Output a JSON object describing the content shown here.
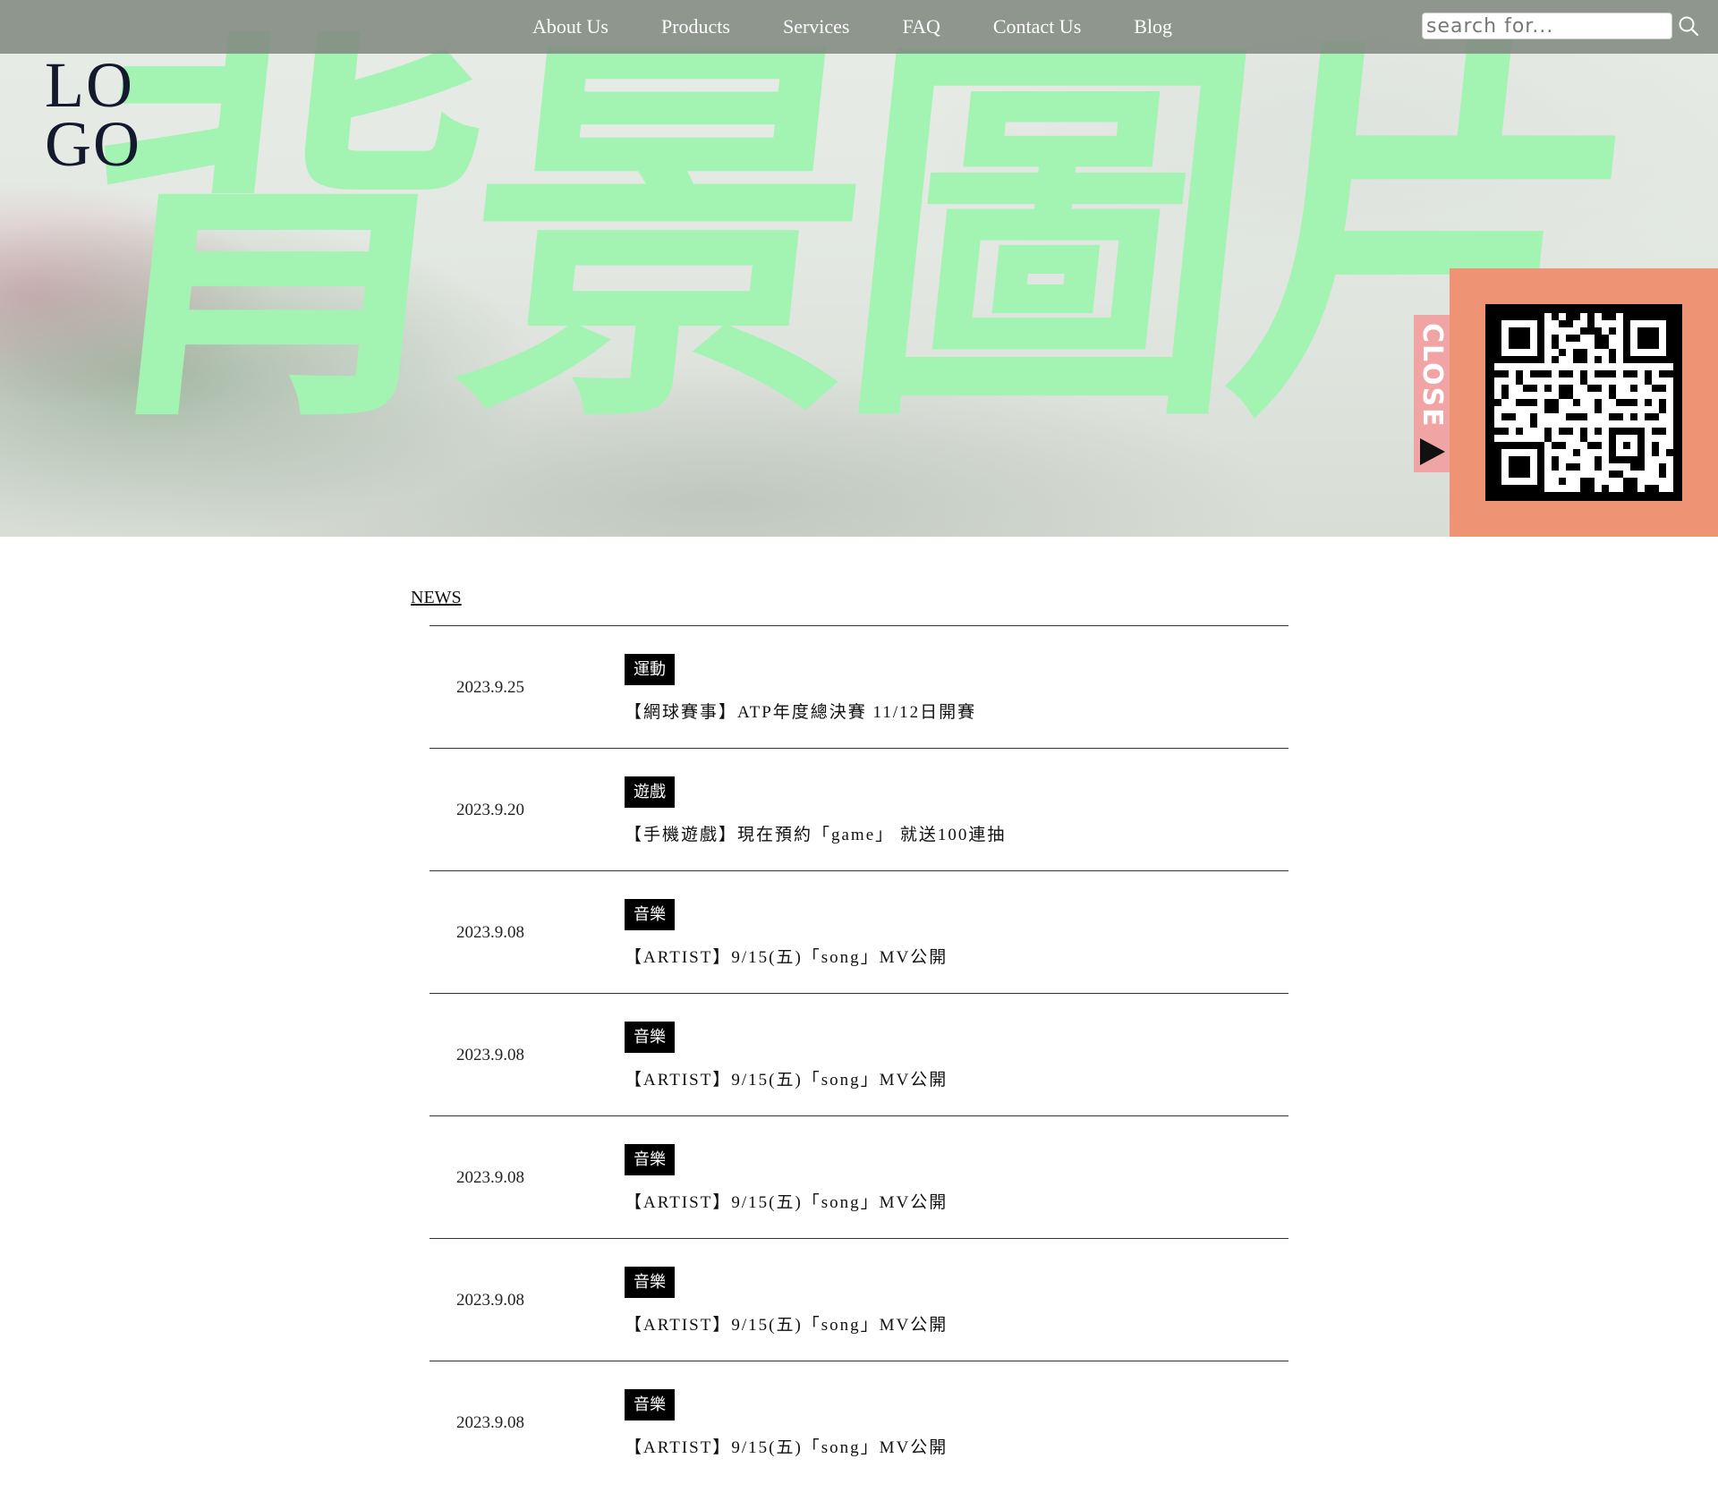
{
  "hero": {
    "background_text": "背景圖片"
  },
  "logo": {
    "line1": "LO",
    "line2": "GO"
  },
  "nav": {
    "items": [
      {
        "label": "About Us"
      },
      {
        "label": "Products"
      },
      {
        "label": "Services"
      },
      {
        "label": "FAQ"
      },
      {
        "label": "Contact Us"
      },
      {
        "label": "Blog"
      }
    ]
  },
  "search": {
    "placeholder": "search for..."
  },
  "qr_panel": {
    "close_label": "CLOSE"
  },
  "news": {
    "heading": "NEWS",
    "items": [
      {
        "date": "2023.9.25",
        "tag": "運動",
        "title": "【網球賽事】ATP年度總決賽 11/12日開賽"
      },
      {
        "date": "2023.9.20",
        "tag": "遊戲",
        "title": "【手機遊戲】現在預約「game」 就送100連抽"
      },
      {
        "date": "2023.9.08",
        "tag": "音樂",
        "title": "【ARTIST】9/15(五)「song」MV公開"
      },
      {
        "date": "2023.9.08",
        "tag": "音樂",
        "title": "【ARTIST】9/15(五)「song」MV公開"
      },
      {
        "date": "2023.9.08",
        "tag": "音樂",
        "title": "【ARTIST】9/15(五)「song」MV公開"
      },
      {
        "date": "2023.9.08",
        "tag": "音樂",
        "title": "【ARTIST】9/15(五)「song」MV公開"
      },
      {
        "date": "2023.9.08",
        "tag": "音樂",
        "title": "【ARTIST】9/15(五)「song」MV公開"
      }
    ]
  },
  "colors": {
    "hero_text": "#a3f3b2",
    "navbar": "#828a82",
    "qr_panel": "#ee9373",
    "close_tab": "#f0a4a4",
    "tag_bg": "#000000"
  }
}
